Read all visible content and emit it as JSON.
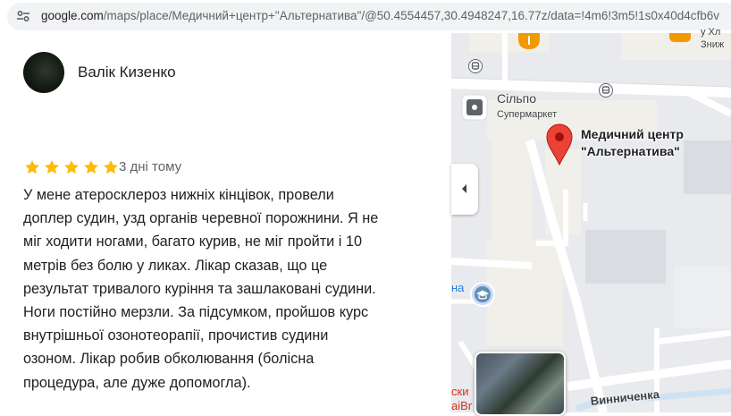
{
  "browser": {
    "url_host": "google.com",
    "url_path": "/maps/place/Медичний+центр+\"Альтернатива\"/@50.4554457,30.4948247,16.77z/data=!4m6!3m5!1s0x40d4cfb6v"
  },
  "review": {
    "reviewer_name": "Валік Кизенко",
    "rating": 5,
    "time_ago": "3 дні тому",
    "text_lines": [
      "У мене атеросклероз нижніх кінцівок, провели",
      "доплер судин, узд органів черевної порожнини. Я не",
      "міг ходити ногами, багато курив, не міг пройти і 10",
      "метрів без болю у ликах. Лікар сказав, що це",
      "результат тривалого куріння та зашлаковані судини.",
      "Ноги постійно мерзли. За підсумком, пройшов курс",
      "внутрішньої озонотеорапії, прочистив судини",
      "озоном. Лікар робив обколювання (болісна",
      "процедура, але дуже допомогла)."
    ]
  },
  "map": {
    "supermarket_name": "Сільпо",
    "supermarket_type": "Супермаркет",
    "pin_label_line1": "Медичний центр",
    "pin_label_line2": "\"Альтернатива\"",
    "street_name": "Винниченка",
    "corner_label_top": "у Хл",
    "corner_label_sub": "Зниж",
    "left_edge_label_1": "на",
    "left_edge_label_2": "ски",
    "left_edge_label_3": "aiBr",
    "colors": {
      "pin": "#ea4335",
      "road": "#ffffff",
      "building": "#f1efe9",
      "block": "#d9dce0",
      "water_label": "#1a73e8"
    }
  },
  "icons": {
    "site_info": "tune-icon",
    "collapse": "chevron-left-icon",
    "bus": "bus-stop-icon",
    "shop": "shop-icon",
    "school": "school-icon",
    "pin": "map-pin-icon",
    "star": "star-icon"
  }
}
